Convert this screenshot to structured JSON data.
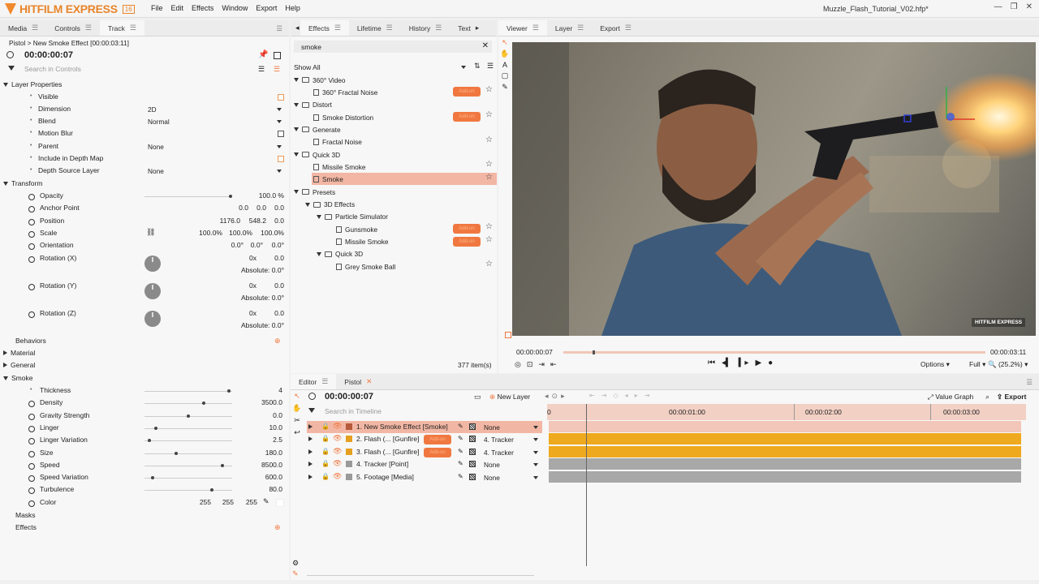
{
  "app": {
    "name": "HITFILM EXPRESS",
    "version": "16",
    "menu": [
      "File",
      "Edit",
      "Effects",
      "Window",
      "Export",
      "Help"
    ],
    "filename": "Muzzle_Flash_Tutorial_V02.hfp*"
  },
  "left_panel": {
    "tabs": [
      "Media",
      "Controls",
      "Track"
    ],
    "breadcrumb": "Pistol > New Smoke Effect [00:00:03:11]",
    "timecode": "00:00:00:07",
    "search_placeholder": "Search in Controls",
    "layer_properties": {
      "title": "Layer Properties",
      "visible": "Visible",
      "dimension": {
        "label": "Dimension",
        "value": "2D"
      },
      "blend": {
        "label": "Blend",
        "value": "Normal"
      },
      "motion_blur": "Motion Blur",
      "parent": {
        "label": "Parent",
        "value": "None"
      },
      "depth_map": "Include in Depth Map",
      "depth_source": {
        "label": "Depth Source Layer",
        "value": "None"
      }
    },
    "transform": {
      "title": "Transform",
      "opacity": {
        "label": "Opacity",
        "value": "100.0 %",
        "level": 1.0
      },
      "anchor": {
        "label": "Anchor Point",
        "v1": "0.0",
        "v2": "0.0",
        "v3": "0.0"
      },
      "position": {
        "label": "Position",
        "v1": "1176.0",
        "v2": "548.2",
        "v3": "0.0"
      },
      "scale": {
        "label": "Scale",
        "v1": "100.0%",
        "v2": "100.0%",
        "v3": "100.0%"
      },
      "orientation": {
        "label": "Orientation",
        "v1": "0.0°",
        "v2": "0.0°",
        "v3": "0.0°"
      },
      "rotation_x": {
        "label": "Rotation (X)",
        "turns": "0x",
        "deg": "0.0",
        "abs": "Absolute: 0.0°"
      },
      "rotation_y": {
        "label": "Rotation (Y)",
        "turns": "0x",
        "deg": "0.0",
        "abs": "Absolute: 0.0°"
      },
      "rotation_z": {
        "label": "Rotation (Z)",
        "turns": "0x",
        "deg": "0.0",
        "abs": "Absolute: 0.0°"
      }
    },
    "sections": {
      "behaviors": "Behaviors",
      "material": "Material",
      "general": "General",
      "smoke": "Smoke",
      "masks": "Masks",
      "effects": "Effects"
    },
    "smoke": [
      {
        "label": "Thickness",
        "value": "4",
        "level": 0.98,
        "key": false
      },
      {
        "label": "Density",
        "value": "3500.0",
        "level": 0.68,
        "key": true
      },
      {
        "label": "Gravity Strength",
        "value": "0.0",
        "level": 0.5,
        "key": true
      },
      {
        "label": "Linger",
        "value": "10.0",
        "level": 0.12,
        "key": true
      },
      {
        "label": "Linger Variation",
        "value": "2.5",
        "level": 0.04,
        "key": true
      },
      {
        "label": "Size",
        "value": "180.0",
        "level": 0.36,
        "key": true
      },
      {
        "label": "Speed",
        "value": "8500.0",
        "level": 0.9,
        "key": true
      },
      {
        "label": "Speed Variation",
        "value": "600.0",
        "level": 0.08,
        "key": true
      },
      {
        "label": "Turbulence",
        "value": "80.0",
        "level": 0.78,
        "key": true
      }
    ],
    "color": {
      "label": "Color",
      "r": "255",
      "g": "255",
      "b": "255"
    }
  },
  "effects_panel": {
    "tabs": [
      "Effects",
      "Lifetime",
      "History",
      "Text"
    ],
    "search": "smoke",
    "filter": "Show All",
    "items": [
      {
        "label": "360° Video",
        "kind": "folder",
        "level": 0
      },
      {
        "label": "360° Fractal Noise",
        "kind": "effect",
        "level": 1,
        "addon": true
      },
      {
        "label": "Distort",
        "kind": "folder",
        "level": 0
      },
      {
        "label": "Smoke Distortion",
        "kind": "effect",
        "level": 1,
        "addon": true
      },
      {
        "label": "Generate",
        "kind": "folder",
        "level": 0
      },
      {
        "label": "Fractal Noise",
        "kind": "effect",
        "level": 1,
        "addon": false
      },
      {
        "label": "Quick 3D",
        "kind": "folder",
        "level": 0
      },
      {
        "label": "Missile Smoke",
        "kind": "effect",
        "level": 1,
        "addon": false
      },
      {
        "label": "Smoke",
        "kind": "effect",
        "level": 1,
        "addon": false,
        "selected": true
      },
      {
        "label": "Presets",
        "kind": "folder",
        "level": 0
      },
      {
        "label": "3D Effects",
        "kind": "folder",
        "level": 1
      },
      {
        "label": "Particle Simulator",
        "kind": "folder",
        "level": 2
      },
      {
        "label": "Gunsmoke",
        "kind": "effect",
        "level": 3,
        "addon": true
      },
      {
        "label": "Missile Smoke",
        "kind": "effect",
        "level": 3,
        "addon": true
      },
      {
        "label": "Quick 3D",
        "kind": "folder",
        "level": 2
      },
      {
        "label": "Grey Smoke Ball",
        "kind": "effect",
        "level": 3,
        "addon": false
      }
    ],
    "count": "377 item(s)",
    "addon_label": "Add-on"
  },
  "viewer": {
    "tabs": [
      "Viewer",
      "Layer",
      "Export"
    ],
    "time_start": "00:00:00:07",
    "time_end": "00:00:03:11",
    "playhead": 0.07,
    "options": "Options",
    "quality": "Full",
    "zoom": "(25.2%)",
    "watermark": "HITFILM EXPRESS"
  },
  "editor": {
    "tabs": [
      "Editor",
      "Pistol"
    ],
    "timecode": "00:00:00:07",
    "new_layer": "New Layer",
    "value_graph": "Value Graph",
    "export": "Export",
    "search_placeholder": "Search in Timeline",
    "ruler": [
      "0",
      "00:00:01:00",
      "00:00:02:00",
      "00:00:03:00"
    ],
    "layers": [
      {
        "name": "1. New Smoke Effect [Smoke]",
        "parent": "None",
        "color": "#b55a3a",
        "addon": false,
        "selected": true,
        "bar": "#f2c6b8"
      },
      {
        "name": "2. Flash (... [Gunfire]",
        "parent": "4. Tracker",
        "color": "#e5a020",
        "addon": true,
        "bar": "#efa91e"
      },
      {
        "name": "3. Flash (... [Gunfire]",
        "parent": "4. Tracker",
        "color": "#e5a020",
        "addon": true,
        "bar": "#efa91e"
      },
      {
        "name": "4. Tracker [Point]",
        "parent": "None",
        "color": "#9a9a9a",
        "addon": false,
        "bar": "#a8a8a8"
      },
      {
        "name": "5. Footage [Media]",
        "parent": "None",
        "color": "#9a9a9a",
        "addon": false,
        "bar": "#a8a8a8"
      }
    ]
  },
  "colors": {
    "accent": "#f07840",
    "selected": "#f2b7a4",
    "gunfire": "#efa91e"
  }
}
